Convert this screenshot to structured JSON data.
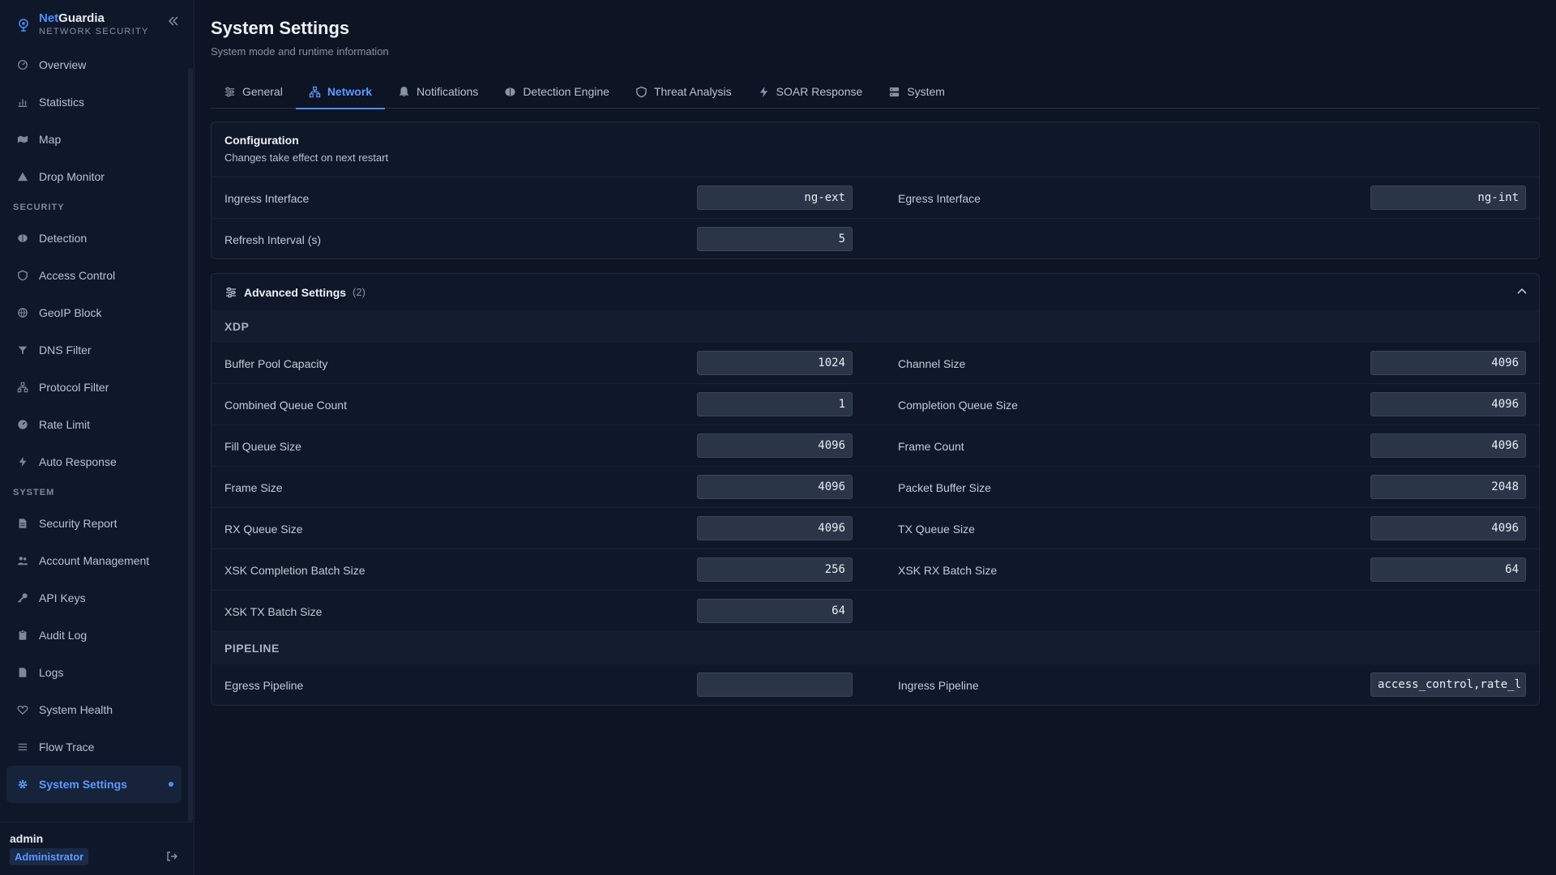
{
  "brand": {
    "name_accent": "Net",
    "name_rest": "Guardia",
    "subtitle": "NETWORK SECURITY"
  },
  "sidebar": {
    "groups": [
      {
        "section": "",
        "items": [
          {
            "label": "Overview",
            "icon": "gauge-icon"
          },
          {
            "label": "Statistics",
            "icon": "bar-chart-icon"
          },
          {
            "label": "Map",
            "icon": "map-icon"
          },
          {
            "label": "Drop Monitor",
            "icon": "warning-icon"
          }
        ]
      },
      {
        "section": "SECURITY",
        "items": [
          {
            "label": "Detection",
            "icon": "brain-icon"
          },
          {
            "label": "Access Control",
            "icon": "shield-icon"
          },
          {
            "label": "GeoIP Block",
            "icon": "globe-icon"
          },
          {
            "label": "DNS Filter",
            "icon": "filter-icon"
          },
          {
            "label": "Protocol Filter",
            "icon": "network-icon"
          },
          {
            "label": "Rate Limit",
            "icon": "speed-icon"
          },
          {
            "label": "Auto Response",
            "icon": "bolt-icon"
          }
        ]
      },
      {
        "section": "SYSTEM",
        "items": [
          {
            "label": "Security Report",
            "icon": "document-icon"
          },
          {
            "label": "Account Management",
            "icon": "users-icon"
          },
          {
            "label": "API Keys",
            "icon": "key-icon"
          },
          {
            "label": "Audit Log",
            "icon": "clipboard-icon"
          },
          {
            "label": "Logs",
            "icon": "file-icon"
          },
          {
            "label": "System Health",
            "icon": "heart-icon"
          },
          {
            "label": "Flow Trace",
            "icon": "list-icon"
          },
          {
            "label": "System Settings",
            "icon": "gear-icon",
            "active": true
          }
        ]
      }
    ]
  },
  "user": {
    "name": "admin",
    "role": "Administrator"
  },
  "page": {
    "title": "System Settings",
    "subtitle": "System mode and runtime information"
  },
  "tabs": [
    {
      "label": "General",
      "icon": "sliders-icon"
    },
    {
      "label": "Network",
      "icon": "network-icon",
      "active": true
    },
    {
      "label": "Notifications",
      "icon": "bell-icon"
    },
    {
      "label": "Detection Engine",
      "icon": "brain-icon"
    },
    {
      "label": "Threat Analysis",
      "icon": "shield-icon"
    },
    {
      "label": "SOAR Response",
      "icon": "bolt-icon"
    },
    {
      "label": "System",
      "icon": "server-icon"
    }
  ],
  "config": {
    "title": "Configuration",
    "description": "Changes take effect on next restart",
    "rows": [
      [
        {
          "label": "Ingress Interface",
          "value": "ng-ext"
        },
        {
          "label": "Egress Interface",
          "value": "ng-int"
        }
      ],
      [
        {
          "label": "Refresh Interval (s)",
          "value": "5"
        }
      ]
    ]
  },
  "advanced": {
    "title": "Advanced Settings",
    "count": "(2)",
    "groups": [
      {
        "name": "XDP",
        "rows": [
          [
            {
              "label": "Buffer Pool Capacity",
              "value": "1024"
            },
            {
              "label": "Channel Size",
              "value": "4096"
            }
          ],
          [
            {
              "label": "Combined Queue Count",
              "value": "1"
            },
            {
              "label": "Completion Queue Size",
              "value": "4096"
            }
          ],
          [
            {
              "label": "Fill Queue Size",
              "value": "4096"
            },
            {
              "label": "Frame Count",
              "value": "4096"
            }
          ],
          [
            {
              "label": "Frame Size",
              "value": "4096"
            },
            {
              "label": "Packet Buffer Size",
              "value": "2048"
            }
          ],
          [
            {
              "label": "RX Queue Size",
              "value": "4096"
            },
            {
              "label": "TX Queue Size",
              "value": "4096"
            }
          ],
          [
            {
              "label": "XSK Completion Batch Size",
              "value": "256"
            },
            {
              "label": "XSK RX Batch Size",
              "value": "64"
            }
          ],
          [
            {
              "label": "XSK TX Batch Size",
              "value": "64"
            }
          ]
        ]
      },
      {
        "name": "PIPELINE",
        "rows": [
          [
            {
              "label": "Egress Pipeline",
              "value": ""
            },
            {
              "label": "Ingress Pipeline",
              "value": "access_control,rate_l"
            }
          ]
        ]
      }
    ]
  }
}
